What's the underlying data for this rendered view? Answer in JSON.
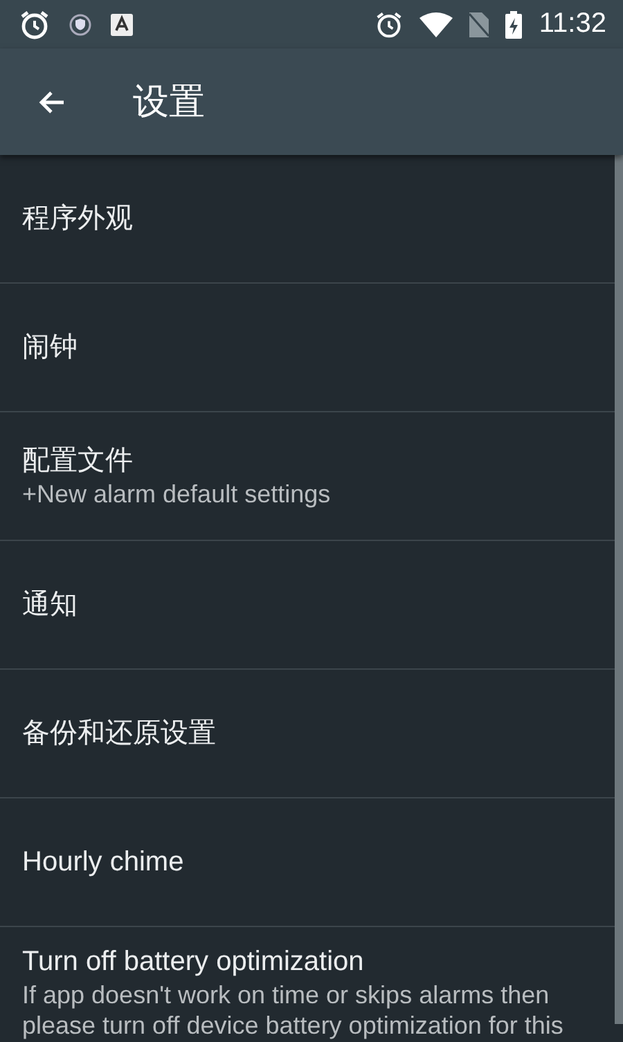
{
  "status_bar": {
    "time": "11:32"
  },
  "toolbar": {
    "title": "设置"
  },
  "items": [
    {
      "title": "程序外观"
    },
    {
      "title": "闹钟"
    },
    {
      "title": "配置文件",
      "summary": "+New alarm default settings"
    },
    {
      "title": "通知"
    },
    {
      "title": "备份和还原设置"
    },
    {
      "title": "Hourly chime"
    },
    {
      "title": "Turn off battery optimization",
      "summary": "If app doesn't work on time or skips alarms then please turn off device battery optimization for this"
    }
  ]
}
